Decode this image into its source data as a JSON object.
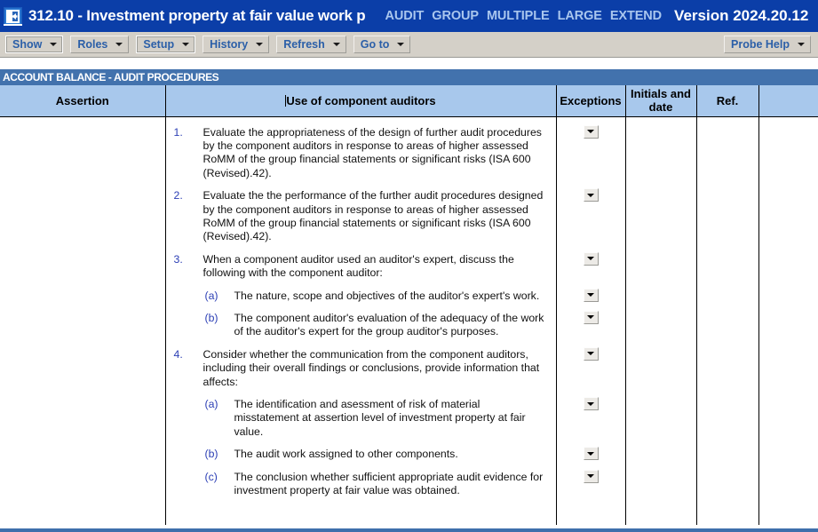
{
  "titlebar": {
    "icon": "restore-window-icon",
    "title": "312.10 - Investment property at fair value work p",
    "tags": [
      "AUDIT",
      "GROUP",
      "MULTIPLE",
      "LARGE",
      "EXTEND"
    ],
    "version": "Version 2024.20.12",
    "accent_color": "#0b3ea8",
    "tag_color": "#a9c6ee"
  },
  "toolbar": {
    "buttons": [
      {
        "label": "Show",
        "icon": "chevron-down-icon"
      },
      {
        "label": "Roles",
        "icon": "chevron-down-icon"
      },
      {
        "label": "Setup",
        "icon": "chevron-down-icon"
      },
      {
        "label": "History",
        "icon": "chevron-down-icon"
      },
      {
        "label": "Refresh",
        "icon": "chevron-down-icon"
      },
      {
        "label": "Go to",
        "icon": "chevron-down-icon"
      }
    ],
    "help": {
      "label": "Probe Help",
      "icon": "chevron-down-icon"
    },
    "background_color": "#d4d0c8",
    "label_color": "#2b5fa8"
  },
  "sheet": {
    "section_header": "ACCOUNT BALANCE - AUDIT PROCEDURES",
    "section_header_color": "#4272ad",
    "header_row_color": "#a8c8ec",
    "columns": [
      {
        "key": "assertion",
        "label": "Assertion"
      },
      {
        "key": "procedure",
        "label": "Use of component auditors"
      },
      {
        "key": "exceptions",
        "label": "Exceptions"
      },
      {
        "key": "initials",
        "label": "Initials and date"
      },
      {
        "key": "ref",
        "label": "Ref."
      },
      {
        "key": "spare",
        "label": ""
      }
    ],
    "procedures": [
      {
        "num": "1.",
        "level": "top",
        "text": "Evaluate the appropriateness of the design of further audit procedures by the component auditors in response to areas of higher assessed RoMM of the group financial statements or significant risks (ISA 600 (Revised).42).",
        "has_exception_dropdown": true
      },
      {
        "num": "2.",
        "level": "top",
        "text": "Evaluate the the performance of the further audit procedures designed by the component auditors in response to areas of higher assessed RoMM of the group financial statements or significant risks (ISA 600 (Revised).42).",
        "has_exception_dropdown": true
      },
      {
        "num": "3.",
        "level": "top",
        "text": "When a component auditor used an auditor's expert, discuss the following with the component auditor:",
        "has_exception_dropdown": true
      },
      {
        "num": "(a)",
        "level": "sub",
        "text": "The nature, scope and objectives of the auditor's expert's work.",
        "has_exception_dropdown": true
      },
      {
        "num": "(b)",
        "level": "sub",
        "text": "The component auditor's evaluation of the adequacy of the work of the auditor's expert for the group auditor's purposes.",
        "has_exception_dropdown": true
      },
      {
        "num": "4.",
        "level": "top",
        "text": "Consider whether the communication from the component auditors, including their overall findings or conclusions, provide information that affects:",
        "has_exception_dropdown": true
      },
      {
        "num": "(a)",
        "level": "sub",
        "text": "The identification and asessment of risk of material misstatement at assertion level of investment property at fair value.",
        "has_exception_dropdown": true
      },
      {
        "num": "(b)",
        "level": "sub",
        "text": "The audit work assigned to other components.",
        "has_exception_dropdown": true
      },
      {
        "num": "(c)",
        "level": "sub",
        "text": "The conclusion whether sufficient appropriate audit evidence for investment property at fair value was obtained.",
        "has_exception_dropdown": true
      }
    ]
  }
}
